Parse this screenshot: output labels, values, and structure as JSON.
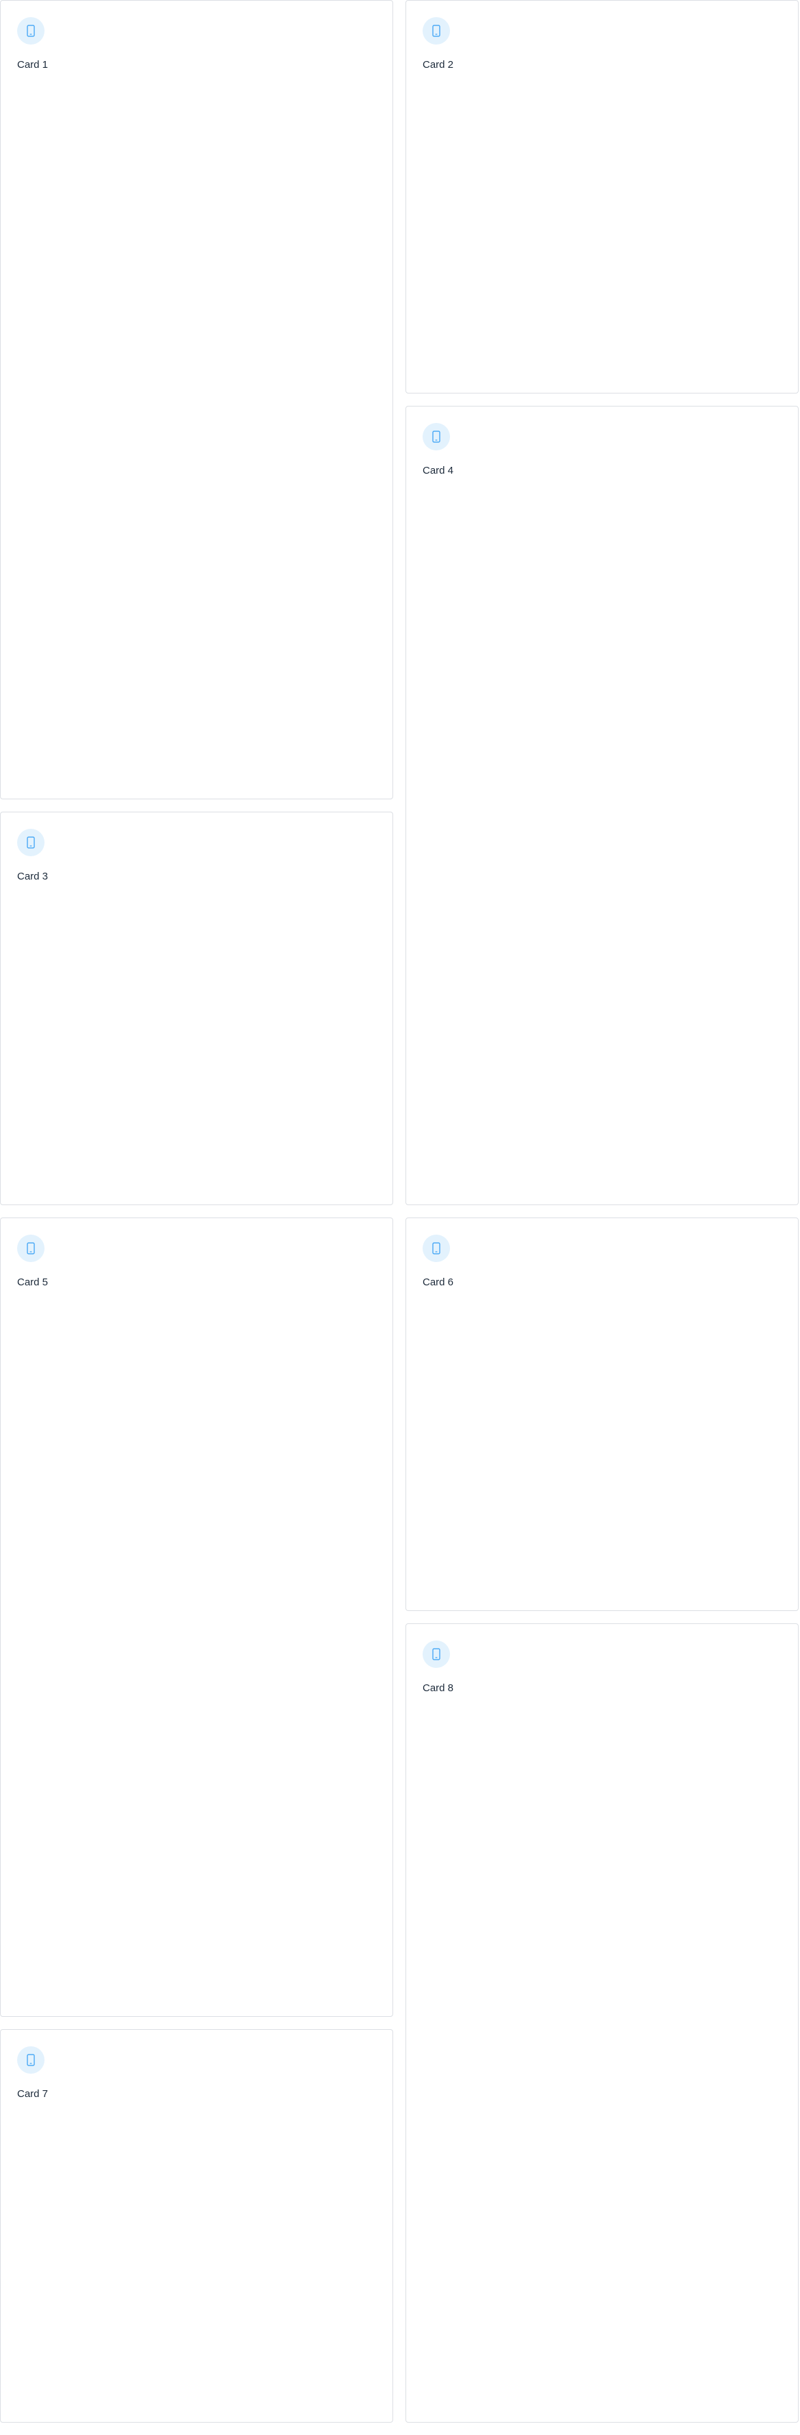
{
  "accent_color": "#42a5f5",
  "icon_background_color": "#e3f2fd",
  "cards": [
    {
      "title": "Card 1",
      "icon": "smartphone-icon",
      "size": "tall"
    },
    {
      "title": "Card 2",
      "icon": "smartphone-icon",
      "size": "short"
    },
    {
      "title": "Card 3",
      "icon": "smartphone-icon",
      "size": "short"
    },
    {
      "title": "Card 4",
      "icon": "smartphone-icon",
      "size": "tall"
    },
    {
      "title": "Card 5",
      "icon": "smartphone-icon",
      "size": "tall"
    },
    {
      "title": "Card 6",
      "icon": "smartphone-icon",
      "size": "short"
    },
    {
      "title": "Card 7",
      "icon": "smartphone-icon",
      "size": "short"
    },
    {
      "title": "Card 8",
      "icon": "smartphone-icon",
      "size": "tall"
    }
  ]
}
